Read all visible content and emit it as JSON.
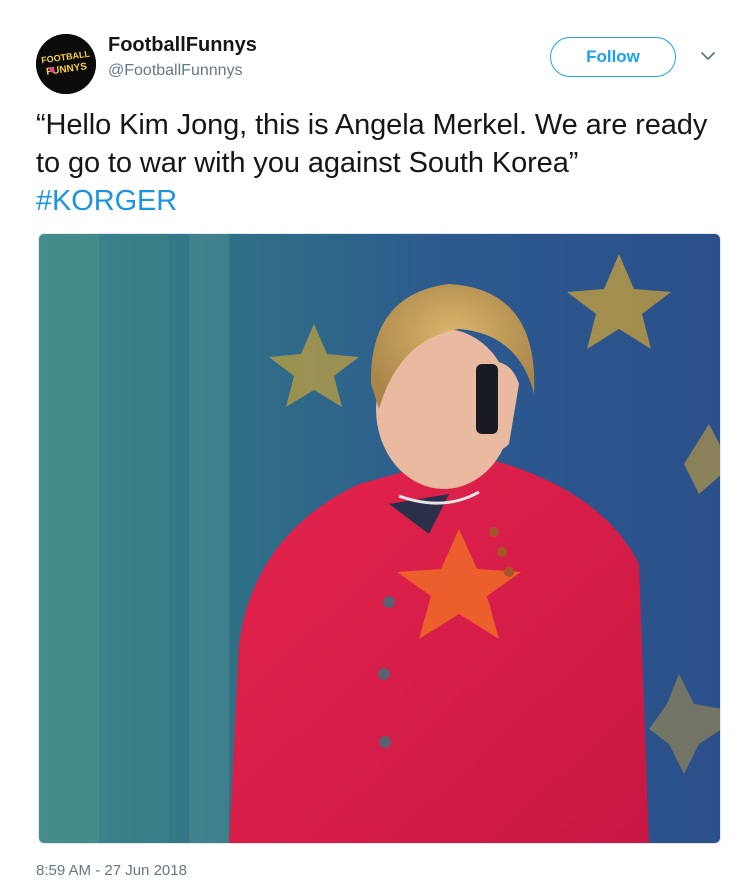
{
  "user": {
    "display_name": "FootballFunnys",
    "handle": "@FootballFunnnys",
    "avatar_text_top": "FOOTBALL",
    "avatar_text_bottom": "FUNNYS"
  },
  "follow_button": {
    "label": "Follow"
  },
  "menu": {
    "icon": "chevron-down-icon"
  },
  "tweet": {
    "text": "“Hello Kim Jong, this is Angela Merkel. We are ready to go to war with you against South Korea” ",
    "hashtag": "#KORGER",
    "timestamp": "8:59 AM - 27 Jun 2018"
  },
  "colors": {
    "accent": "#1da1f2",
    "hashtag": "#1b95e0",
    "secondary_text": "#657786"
  }
}
